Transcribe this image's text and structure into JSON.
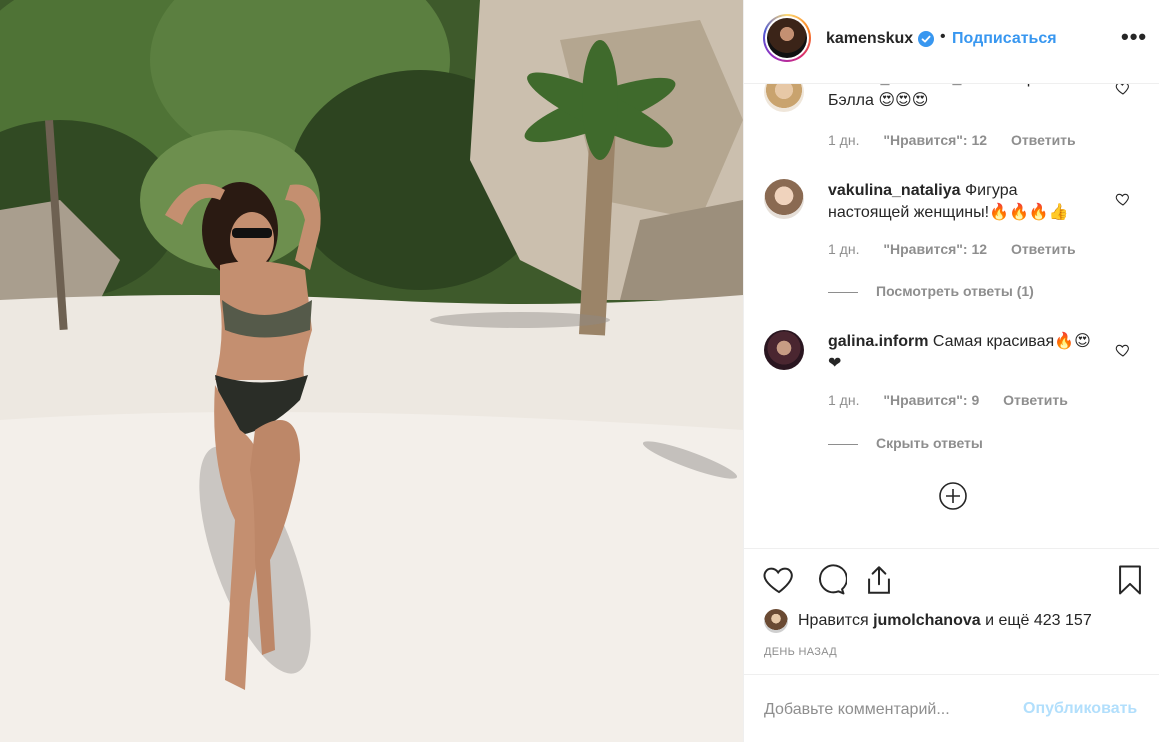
{
  "post": {
    "username": "kamenskux",
    "dot": "•",
    "follow_label": "Подписаться",
    "more_icon": "more-horizontal-icon",
    "more_glyph": "•••",
    "photo_alt": "photo"
  },
  "comments": [
    {
      "username": "andrea_albrandt_official",
      "text": "Красотка Бэлла 😍😍😍",
      "age": "1 дн.",
      "likes": "\"Нравится\": 12",
      "reply_label": "Ответить"
    },
    {
      "username": "vakulina_nataliya",
      "text": "Фигура настоящей женщины!🔥🔥🔥👍",
      "age": "1 дн.",
      "likes": "\"Нравится\": 12",
      "reply_label": "Ответить",
      "thread_label": "Посмотреть ответы (1)"
    },
    {
      "username": "galina.inform",
      "text": "Самая красивая🔥😍❤",
      "age": "1 дн.",
      "likes": "\"Нравится\": 9",
      "reply_label": "Ответить",
      "thread_label": "Скрыть ответы"
    }
  ],
  "actions": {
    "liked_by_prefix": "Нравится",
    "liked_by_user": "jumolchanova",
    "liked_by_suffix": "и ещё 423 157",
    "timestamp": "День назад"
  },
  "add_comment": {
    "placeholder": "Добавьте комментарий...",
    "post_label": "Опубликовать"
  },
  "colors": {
    "accent": "#3897f0",
    "post_disabled": "#b2dffc",
    "muted": "#8e8e8e"
  }
}
